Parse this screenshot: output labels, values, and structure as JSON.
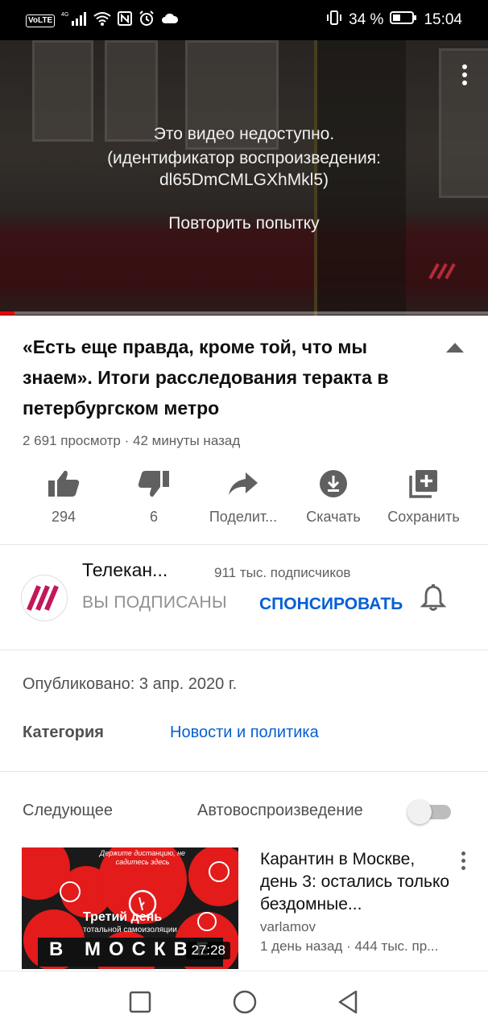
{
  "status_bar": {
    "volte": "VoLTE",
    "network": "4G",
    "battery_percent": "34 %",
    "time": "15:04"
  },
  "player": {
    "error_line1": "Это видео недоступно.",
    "error_line2": "(идентификатор воспроизведения:",
    "error_line3": "dl65DmCMLGXhMkl5)",
    "retry": "Повторить попытку"
  },
  "video": {
    "title": "«Есть еще правда, кроме той, что мы знаем». Итоги расследования теракта в петербургском метро",
    "meta": "2 691 просмотр · 42 минуты назад"
  },
  "actions": {
    "like": "294",
    "dislike": "6",
    "share": "Поделит...",
    "download": "Скачать",
    "save": "Сохранить"
  },
  "channel": {
    "name": "Телекан...",
    "subscribers": "911 тыс. подписчиков",
    "subscribed": "ВЫ ПОДПИСАНЫ",
    "sponsor": "СПОНСИРОВАТЬ"
  },
  "details": {
    "published": "Опубликовано: 3 апр. 2020 г.",
    "category_label": "Категория",
    "category_value": "Новости и политика"
  },
  "up_next": {
    "label": "Следующее",
    "autoplay": "Автовоспроизведение",
    "autoplay_enabled": false
  },
  "next_video": {
    "title": "Карантин в Москве, день 3: остались только бездомные...",
    "channel": "varlamov",
    "meta": "1 день назад · 444 тыс. пр...",
    "duration": "27:28",
    "thumb_text_small": "Держите дистанцию, не садитесь здесь",
    "thumb_text_day": "Третий день",
    "thumb_text_sub": "тотальной самоизоляции",
    "thumb_text_city": "В МОСКВЕ"
  },
  "colors": {
    "accent_blue": "#065fd4",
    "progress_red": "#ff0000",
    "thumb_red": "#e31b1b",
    "channel_logo": "#c2185b"
  }
}
